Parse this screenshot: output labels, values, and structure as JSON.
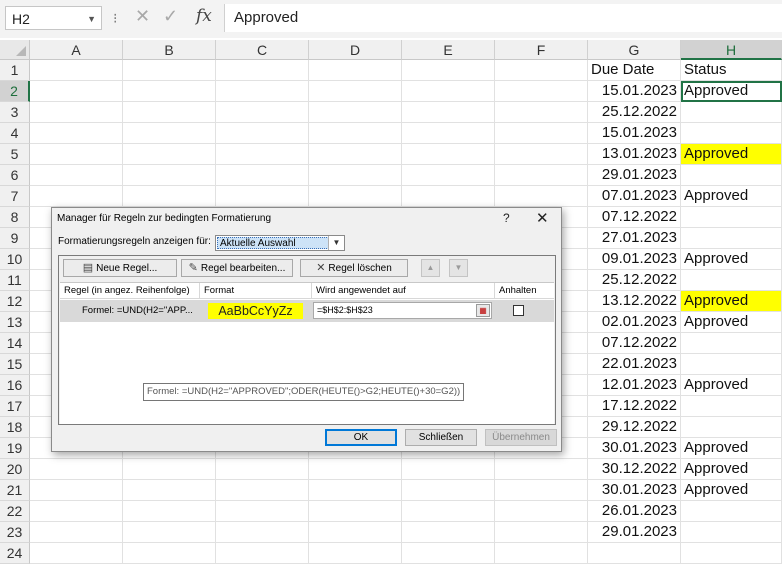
{
  "formula_bar": {
    "name_box": "H2",
    "cancel_glyph": "✕",
    "enter_glyph": "✓",
    "fx_label": "fx",
    "value": "Approved"
  },
  "columns": [
    "A",
    "B",
    "C",
    "D",
    "E",
    "F",
    "G",
    "H"
  ],
  "selected_column": "H",
  "row_numbers": [
    "1",
    "2",
    "3",
    "4",
    "5",
    "6",
    "7",
    "8",
    "9",
    "10",
    "11",
    "12",
    "13",
    "14",
    "15",
    "16",
    "17",
    "18",
    "19",
    "20",
    "21",
    "22",
    "23",
    "24"
  ],
  "selected_row": "2",
  "sheet": {
    "g_header": "Due Date",
    "h_header": "Status",
    "rows": [
      {
        "date": "15.01.2023",
        "status": "Approved",
        "highlight": false
      },
      {
        "date": "25.12.2022",
        "status": "",
        "highlight": false
      },
      {
        "date": "15.01.2023",
        "status": "",
        "highlight": false
      },
      {
        "date": "13.01.2023",
        "status": "Approved",
        "highlight": true
      },
      {
        "date": "29.01.2023",
        "status": "",
        "highlight": false
      },
      {
        "date": "07.01.2023",
        "status": "Approved",
        "highlight": false
      },
      {
        "date": "07.12.2022",
        "status": "",
        "highlight": false
      },
      {
        "date": "27.01.2023",
        "status": "",
        "highlight": false
      },
      {
        "date": "09.01.2023",
        "status": "Approved",
        "highlight": false
      },
      {
        "date": "25.12.2022",
        "status": "",
        "highlight": false
      },
      {
        "date": "13.12.2022",
        "status": "Approved",
        "highlight": true
      },
      {
        "date": "02.01.2023",
        "status": "Approved",
        "highlight": false
      },
      {
        "date": "07.12.2022",
        "status": "",
        "highlight": false
      },
      {
        "date": "22.01.2023",
        "status": "",
        "highlight": false
      },
      {
        "date": "12.01.2023",
        "status": "Approved",
        "highlight": false
      },
      {
        "date": "17.12.2022",
        "status": "",
        "highlight": false
      },
      {
        "date": "29.12.2022",
        "status": "",
        "highlight": false
      },
      {
        "date": "30.01.2023",
        "status": "Approved",
        "highlight": false
      },
      {
        "date": "30.12.2022",
        "status": "Approved",
        "highlight": false
      },
      {
        "date": "30.01.2023",
        "status": "Approved",
        "highlight": false
      },
      {
        "date": "26.01.2023",
        "status": "",
        "highlight": false
      },
      {
        "date": "29.01.2023",
        "status": "",
        "highlight": false
      },
      {
        "date": "",
        "status": "",
        "highlight": false
      }
    ]
  },
  "dialog": {
    "title": "Manager für Regeln zur bedingten Formatierung",
    "help": "?",
    "close": "✕",
    "show_rules_label": "Formatierungsregeln anzeigen für:",
    "show_rules_value": "Aktuelle Auswahl",
    "new_rule": "Neue Regel...",
    "edit_rule": "Regel bearbeiten...",
    "delete_rule": "Regel löschen",
    "move_up": "▲",
    "move_down": "▼",
    "col_rule": "Regel (in angez. Reihenfolge)",
    "col_format": "Format",
    "col_applies": "Wird angewendet auf",
    "col_stop": "Anhalten",
    "rule_formula": "Formel: =UND(H2=\"APP...",
    "rule_preview": "AaBbCcYyZz",
    "rule_range": "=$H$2:$H$23",
    "tooltip": "Formel: =UND(H2=\"APPROVED\";ODER(HEUTE()>G2;HEUTE()+30=G2))",
    "ok": "OK",
    "close_btn": "Schließen",
    "apply": "Übernehmen"
  },
  "colors": {
    "highlight": "#ffff00",
    "excel_green": "#217346"
  }
}
